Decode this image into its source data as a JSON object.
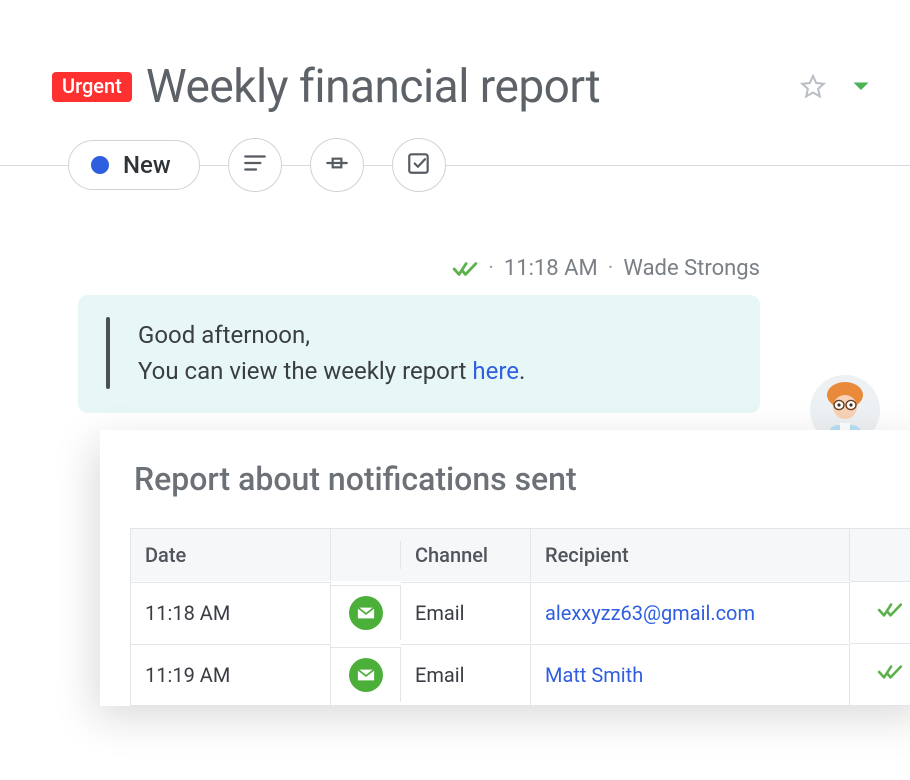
{
  "header": {
    "badge": "Urgent",
    "title": "Weekly financial report"
  },
  "toolbar": {
    "status_label": "New"
  },
  "message": {
    "time": "11:18 AM",
    "author": "Wade Strongs",
    "greeting": "Good afternoon,",
    "body_prefix": "You can view the weekly report ",
    "link_text": "here",
    "body_suffix": "."
  },
  "report": {
    "title": "Report about notifications sent",
    "columns": {
      "date": "Date",
      "channel": "Channel",
      "recipient": "Recipient"
    },
    "rows": [
      {
        "date": "11:18 AM",
        "channel": "Email",
        "recipient": "alexxyzz63@gmail.com"
      },
      {
        "date": "11:19 AM",
        "channel": "Email",
        "recipient": "Matt Smith"
      }
    ]
  }
}
